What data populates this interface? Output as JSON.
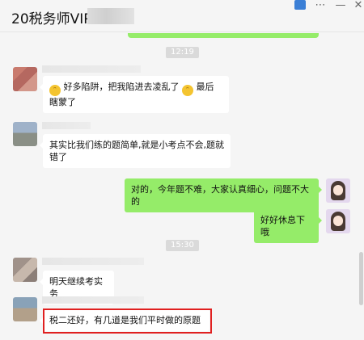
{
  "window": {
    "title": "20税务师VIP",
    "controls": {
      "pin": "pin-icon",
      "menu": "⋯",
      "minimize": "—",
      "close": "✕"
    }
  },
  "chat": {
    "timestamps": [
      "12:19",
      "15:30"
    ],
    "messages": [
      {
        "side": "left",
        "segments": [
          "好多陷阱，把我陷进去凌乱了",
          "最后瞎蒙了"
        ],
        "emoji": "sweat-smile-icon"
      },
      {
        "side": "left",
        "text": "其实比我们练的题简单,就是小考点不会,题就错了"
      },
      {
        "side": "right",
        "text": "对的，今年题不难，大家认真细心，问题不大的"
      },
      {
        "side": "right",
        "text": "好好休息下哦"
      },
      {
        "side": "left",
        "text": "明天继续考实务"
      },
      {
        "side": "left",
        "text": "税二还好，有几道是我们平时做的原题",
        "highlighted": true
      }
    ]
  },
  "colors": {
    "bubble_right": "#95ec69",
    "bubble_left": "#ffffff",
    "highlight": "#e02020",
    "background": "#f5f5f5"
  }
}
